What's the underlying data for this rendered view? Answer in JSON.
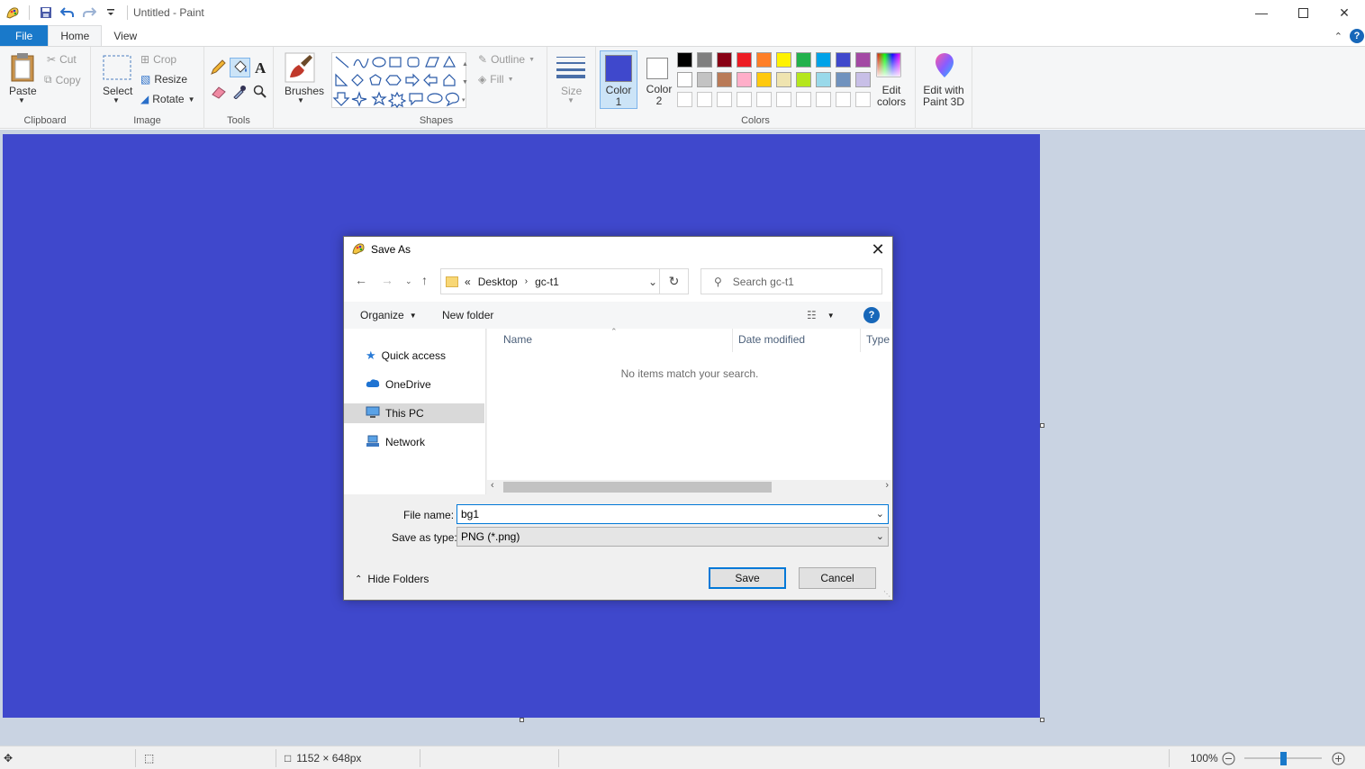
{
  "window": {
    "title": "Untitled - Paint"
  },
  "tabs": {
    "file": "File",
    "home": "Home",
    "view": "View"
  },
  "ribbon": {
    "clipboard": {
      "label": "Clipboard",
      "paste": "Paste",
      "cut": "Cut",
      "copy": "Copy"
    },
    "image": {
      "label": "Image",
      "select": "Select",
      "crop": "Crop",
      "resize": "Resize",
      "rotate": "Rotate"
    },
    "tools": {
      "label": "Tools"
    },
    "brushes": {
      "label": "Brushes"
    },
    "shapes": {
      "label": "Shapes",
      "outline": "Outline",
      "fill": "Fill"
    },
    "size": {
      "label": "Size"
    },
    "colors": {
      "label": "Colors",
      "color1": "Color 1",
      "color1_line1": "Color",
      "color1_line2": "1",
      "color2_line1": "Color",
      "color2_line2": "2",
      "color1_value": "#3f48cc",
      "color2_value": "#ffffff",
      "edit_line1": "Edit",
      "edit_line2": "colors",
      "palette_row1": [
        "#000000",
        "#7f7f7f",
        "#880015",
        "#ed1c24",
        "#ff7f27",
        "#fff200",
        "#22b14c",
        "#00a2e8",
        "#3f48cc",
        "#a349a4"
      ],
      "palette_row2": [
        "#ffffff",
        "#c3c3c3",
        "#b97a57",
        "#ffaec9",
        "#ffc90e",
        "#efe4b0",
        "#b5e61d",
        "#99d9ea",
        "#7092be",
        "#c8bfe7"
      ]
    },
    "paint3d": {
      "line1": "Edit with",
      "line2": "Paint 3D"
    }
  },
  "canvas": {
    "fill_color": "#3f48cc"
  },
  "statusbar": {
    "dimensions": "1152 × 648px",
    "zoom": "100%"
  },
  "dialog": {
    "title": "Save As",
    "breadcrumb": {
      "overflow": "«",
      "segments": [
        "Desktop",
        "gc-t1"
      ]
    },
    "search_placeholder": "Search gc-t1",
    "organize": "Organize",
    "new_folder": "New folder",
    "nav": [
      {
        "label": "Quick access"
      },
      {
        "label": "OneDrive"
      },
      {
        "label": "This PC"
      },
      {
        "label": "Network"
      }
    ],
    "columns": [
      "Name",
      "Date modified",
      "Type"
    ],
    "empty_message": "No items match your search.",
    "file_name_label": "File name:",
    "file_name_value": "bg1",
    "save_type_label": "Save as type:",
    "save_type_value": "PNG (*.png)",
    "hide_folders": "Hide Folders",
    "save": "Save",
    "cancel": "Cancel"
  }
}
